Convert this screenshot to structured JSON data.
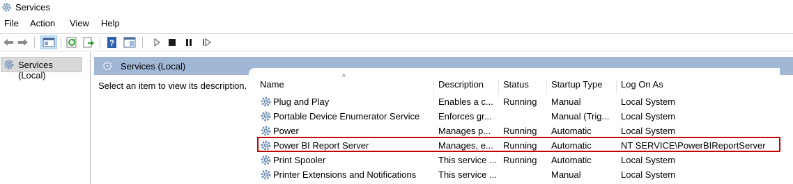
{
  "window": {
    "title": "Services"
  },
  "menu": [
    {
      "id": "file",
      "label": "File"
    },
    {
      "id": "action",
      "label": "Action"
    },
    {
      "id": "view",
      "label": "View"
    },
    {
      "id": "help",
      "label": "Help"
    }
  ],
  "toolbar": [
    {
      "name": "back-button",
      "icon": "arrow-left-icon"
    },
    {
      "name": "forward-button",
      "icon": "arrow-right-icon"
    },
    {
      "name": "show-hide-console-tree-button",
      "icon": "console-tree-icon"
    },
    {
      "name": "refresh-button",
      "icon": "refresh-icon"
    },
    {
      "name": "export-list-button",
      "icon": "export-icon"
    },
    {
      "name": "help-button",
      "icon": "help-icon"
    },
    {
      "name": "properties-button",
      "icon": "properties-icon"
    },
    {
      "name": "start-service-button",
      "icon": "play-icon"
    },
    {
      "name": "stop-service-button",
      "icon": "stop-icon"
    },
    {
      "name": "pause-service-button",
      "icon": "pause-icon"
    },
    {
      "name": "resume-service-button",
      "icon": "resume-icon"
    }
  ],
  "tree": {
    "selected_label": "Services (Local)"
  },
  "right_pane": {
    "header_label": "Services (Local)",
    "description_prompt": "Select an item to view its description."
  },
  "columns": [
    {
      "id": "name",
      "label": "Name"
    },
    {
      "id": "description",
      "label": "Description"
    },
    {
      "id": "status",
      "label": "Status"
    },
    {
      "id": "startup",
      "label": "Startup Type"
    },
    {
      "id": "logon",
      "label": "Log On As"
    }
  ],
  "sort": {
    "column": "name",
    "direction": "ascending",
    "glyph": "^"
  },
  "services": [
    {
      "name": "Plug and Play",
      "description": "Enables a c...",
      "status": "Running",
      "startup": "Manual",
      "logon": "Local System",
      "highlighted": false
    },
    {
      "name": "Portable Device Enumerator Service",
      "description": "Enforces gr...",
      "status": "",
      "startup": "Manual (Trig...",
      "logon": "Local System",
      "highlighted": false
    },
    {
      "name": "Power",
      "description": "Manages p...",
      "status": "Running",
      "startup": "Automatic",
      "logon": "Local System",
      "highlighted": false
    },
    {
      "name": "Power BI Report Server",
      "description": "Manages, e...",
      "status": "Running",
      "startup": "Automatic",
      "logon": "NT SERVICE\\PowerBIReportServer",
      "highlighted": true
    },
    {
      "name": "Print Spooler",
      "description": "This service ...",
      "status": "Running",
      "startup": "Automatic",
      "logon": "Local System",
      "highlighted": false
    },
    {
      "name": "Printer Extensions and Notifications",
      "description": "This service ...",
      "status": "",
      "startup": "Manual",
      "logon": "Local System",
      "highlighted": false
    }
  ],
  "colors": {
    "header_bar": "#a0b8d6",
    "tree_selection": "#d9d9d9",
    "highlight_border": "#c40000",
    "gear_icon": "#6e8fb5"
  }
}
